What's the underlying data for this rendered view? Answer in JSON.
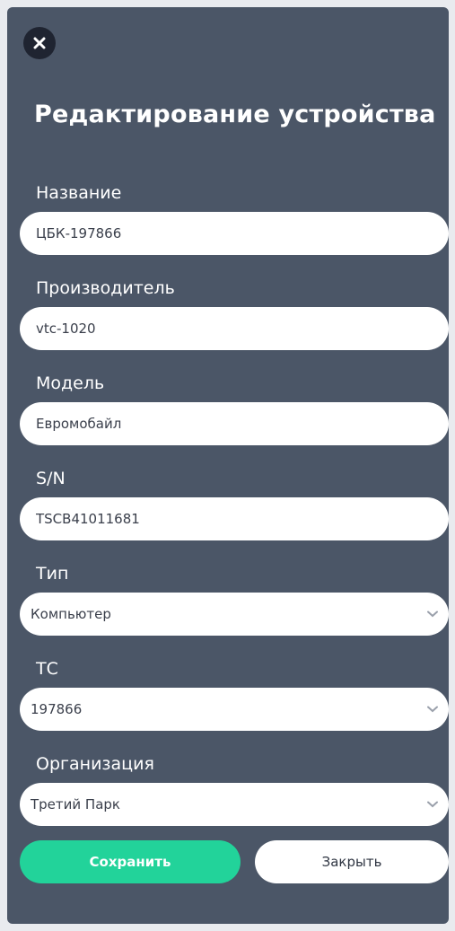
{
  "dialog": {
    "title": "Редактирование устройства",
    "close_icon": "close-icon"
  },
  "fields": {
    "name": {
      "label": "Название",
      "value": "ЦБК-197866"
    },
    "manufacturer": {
      "label": "Производитель",
      "value": "vtc-1020"
    },
    "model": {
      "label": "Модель",
      "value": "Евромобайл"
    },
    "serial": {
      "label": "S/N",
      "value": "TSCB41011681"
    },
    "type": {
      "label": "Тип",
      "value": "Компьютер"
    },
    "vehicle": {
      "label": "ТС",
      "value": "197866"
    },
    "organization": {
      "label": "Организация",
      "value": "Третий Парк"
    }
  },
  "actions": {
    "save_label": "Сохранить",
    "close_label": "Закрыть"
  },
  "colors": {
    "panel": "#4b5667",
    "save": "#22d39a",
    "close_circle": "#1f2431"
  }
}
